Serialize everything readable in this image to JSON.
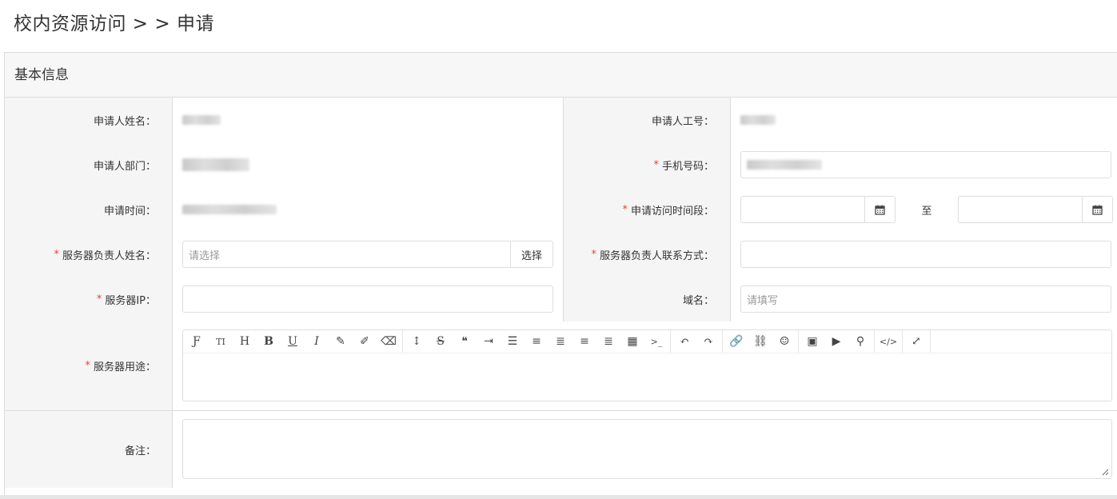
{
  "page": {
    "title": "校内资源访问 > > 申请"
  },
  "section": {
    "title": "基本信息"
  },
  "form": {
    "applicant_name": {
      "label": "申请人姓名："
    },
    "applicant_id": {
      "label": "申请人工号："
    },
    "applicant_dept": {
      "label": "申请人部门："
    },
    "phone": {
      "label": "手机号码：",
      "required_mark": "*"
    },
    "apply_time": {
      "label": "申请时间："
    },
    "access_period": {
      "label": "申请访问时间段：",
      "required_mark": "*",
      "separator": "至"
    },
    "server_owner_name": {
      "label": "服务器负责人姓名：",
      "required_mark": "*",
      "placeholder": "请选择",
      "select_button": "选择"
    },
    "server_owner_contact": {
      "label": "服务器负责人联系方式：",
      "required_mark": "*"
    },
    "server_ip": {
      "label": "服务器IP：",
      "required_mark": "*"
    },
    "domain": {
      "label": "域名：",
      "placeholder": "请填写"
    },
    "server_usage": {
      "label": "服务器用途：",
      "required_mark": "*"
    },
    "remarks": {
      "label": "备注："
    }
  },
  "editor_toolbar": {
    "groups": [
      [
        "font-icon",
        "text-size-icon",
        "heading-icon",
        "bold-icon",
        "underline-icon",
        "italic-icon",
        "pencil-icon",
        "brush-icon",
        "eraser-icon"
      ],
      [
        "line-height-icon",
        "strikethrough-icon",
        "quote-icon",
        "indent-icon",
        "unordered-list-icon",
        "ordered-list-icon",
        "align-left-icon",
        "align-center-icon",
        "align-right-icon",
        "table-icon",
        "code-icon"
      ],
      [
        "undo-icon",
        "redo-icon"
      ],
      [
        "link-icon",
        "unlink-icon",
        "emoji-icon"
      ],
      [
        "image-icon",
        "video-icon",
        "location-icon"
      ],
      [
        "source-code-icon"
      ],
      [
        "fullscreen-icon"
      ]
    ],
    "glyphs": {
      "font-icon": "Ƒ",
      "text-size-icon": "TI",
      "heading-icon": "H",
      "bold-icon": "B",
      "underline-icon": "U",
      "italic-icon": "I",
      "pencil-icon": "✎",
      "brush-icon": "✐",
      "eraser-icon": "⌫",
      "line-height-icon": "↕",
      "strikethrough-icon": "S",
      "quote-icon": "❝",
      "indent-icon": "⇥",
      "unordered-list-icon": "☰",
      "ordered-list-icon": "≡",
      "align-left-icon": "≣",
      "align-center-icon": "≡",
      "align-right-icon": "≣",
      "table-icon": "▦",
      "code-icon": ">_",
      "undo-icon": "↶",
      "redo-icon": "↷",
      "link-icon": "🔗",
      "unlink-icon": "⛓",
      "emoji-icon": "☺",
      "image-icon": "▣",
      "video-icon": "▶",
      "location-icon": "⚲",
      "source-code-icon": "</>",
      "fullscreen-icon": "⤢"
    }
  },
  "colors": {
    "required": "#e4462e",
    "label_bg": "#f5f5f5",
    "border": "#dcdcdc"
  }
}
